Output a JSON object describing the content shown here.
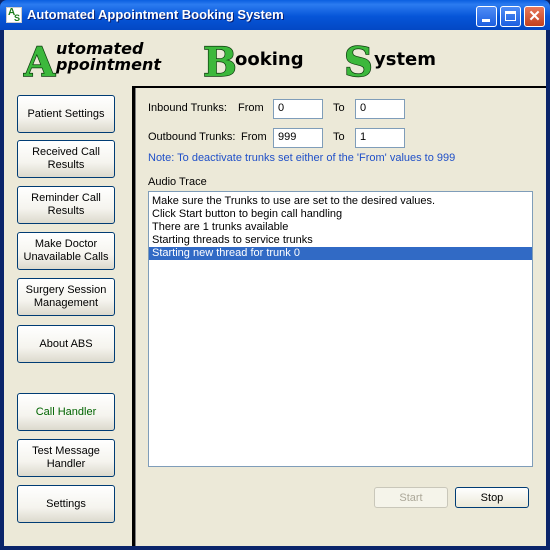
{
  "window": {
    "title": "Automated Appointment Booking System",
    "icon": "abs-app-icon",
    "icon_text": [
      "A",
      "S"
    ]
  },
  "logo": {
    "initials": [
      "A",
      "B",
      "S"
    ],
    "rest": [
      "utomated",
      "ppointment",
      "ooking",
      "ystem"
    ]
  },
  "nav": [
    {
      "label": "Patient Settings",
      "active": false
    },
    {
      "label": "Received Call Results",
      "active": false
    },
    {
      "label": "Reminder Call Results",
      "active": false
    },
    {
      "label": "Make Doctor Unavailable Calls",
      "active": false
    },
    {
      "label": "Surgery Session Management",
      "active": false
    },
    {
      "label": "About ABS",
      "active": false
    },
    {
      "label": "Call Handler",
      "active": true
    },
    {
      "label": "Test Message Handler",
      "active": false
    },
    {
      "label": "Settings",
      "active": false
    }
  ],
  "trunks": {
    "inbound_label": "Inbound Trunks:",
    "outbound_label": "Outbound Trunks:",
    "from_label": "From",
    "to_label": "To",
    "inbound_from": "0",
    "inbound_to": "0",
    "outbound_from": "999",
    "outbound_to": "1",
    "note": "Note: To deactivate trunks set either of the 'From' values to 999"
  },
  "audio_trace": {
    "label": "Audio Trace",
    "lines": [
      "Make sure the Trunks to use are set to the desired values.",
      "Click Start button to begin call handling",
      "There are 1 trunks available",
      "Starting threads to service trunks",
      "Starting new thread for trunk 0"
    ],
    "selected_index": 4
  },
  "buttons": {
    "start": "Start",
    "stop": "Stop",
    "start_enabled": false
  },
  "colors": {
    "title_bar": "#0a5fe0",
    "face": "#ece9d8",
    "note": "#2050c8",
    "selection": "#316ac5",
    "active_nav": "#006400",
    "logo_green": "#3cb83c"
  }
}
